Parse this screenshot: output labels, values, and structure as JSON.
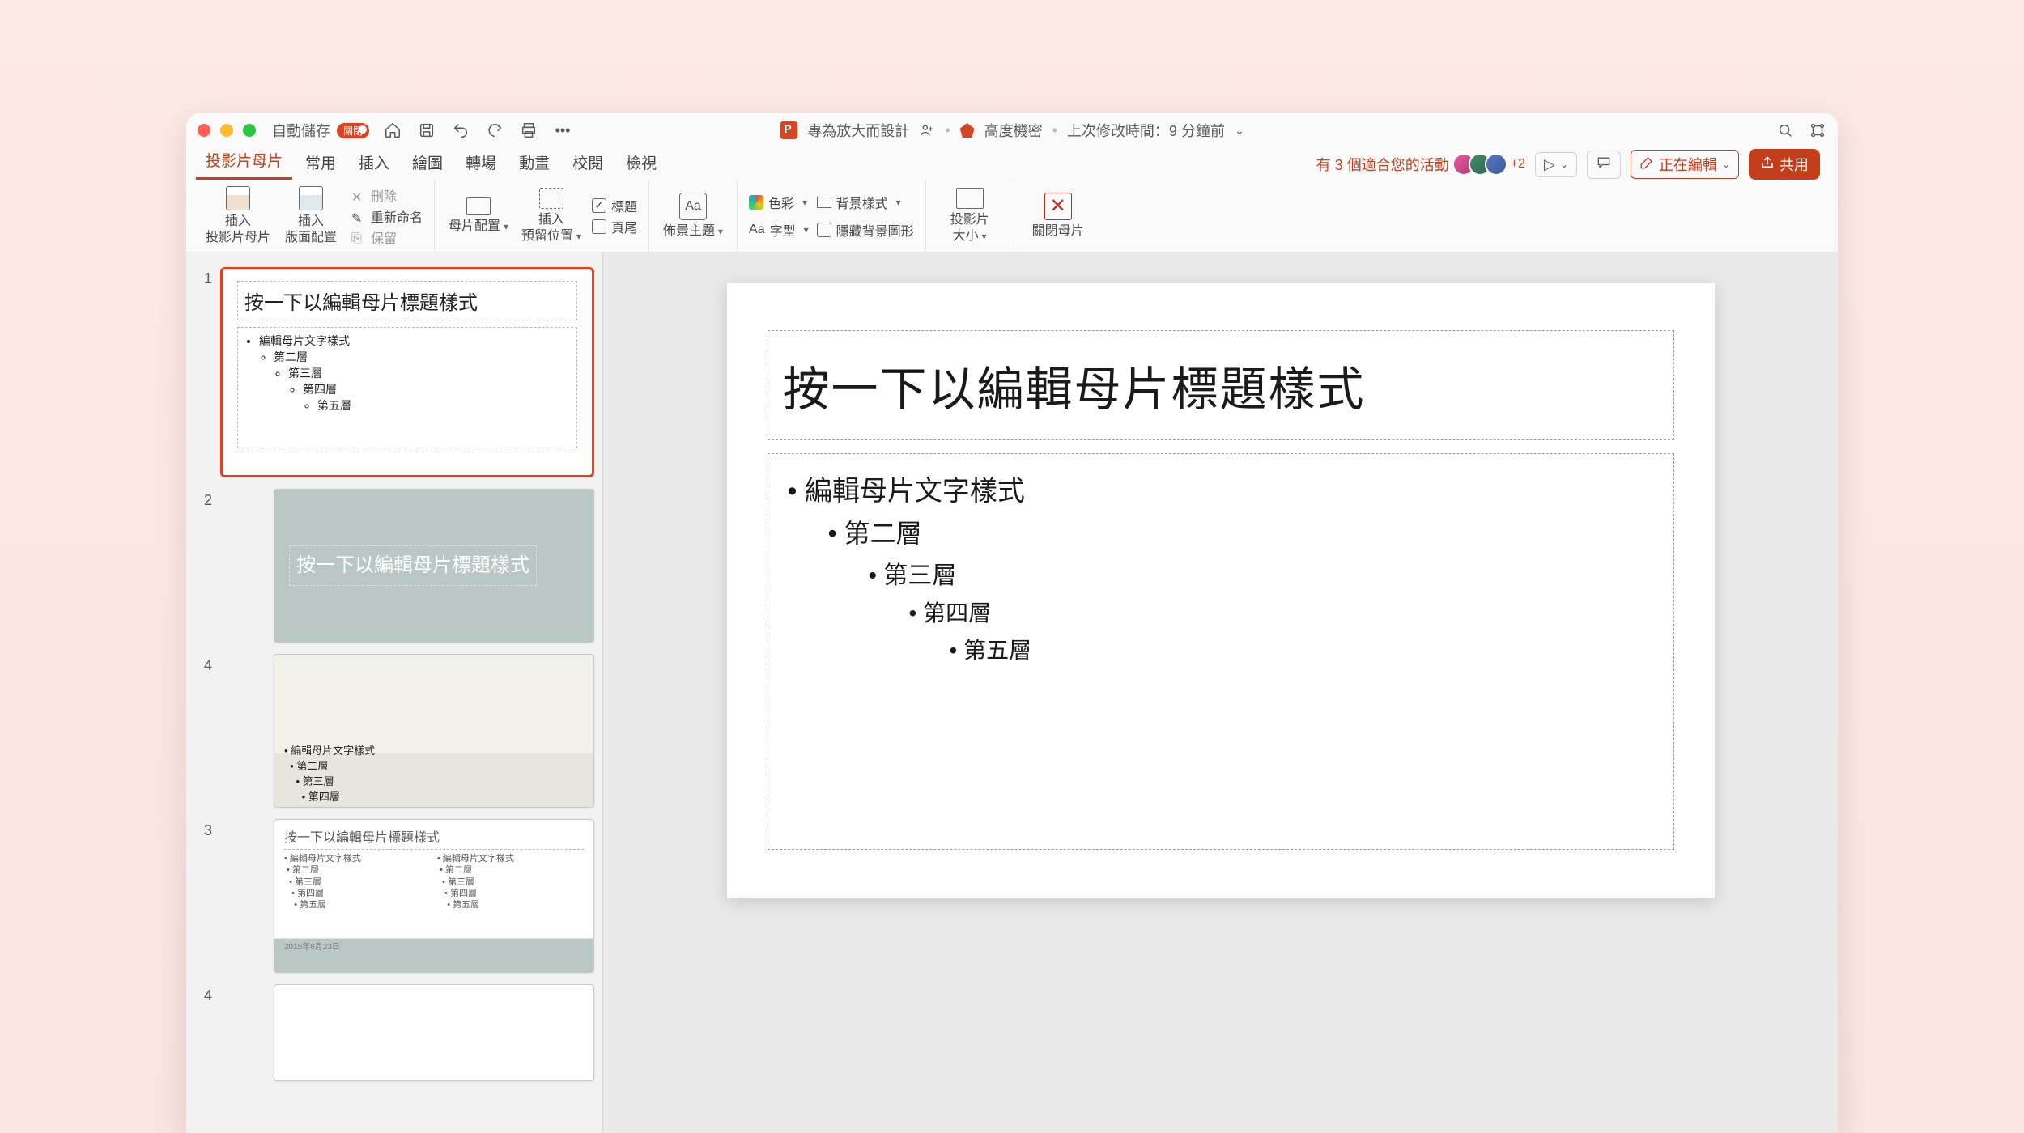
{
  "titlebar": {
    "autosave_label": "自動儲存",
    "autosave_state": "關閉",
    "doc_title": "專為放大而設計",
    "sensitivity": "高度機密",
    "last_modified": "上次修改時間：9 分鐘前"
  },
  "tabs": {
    "slide_master": "投影片母片",
    "home": "常用",
    "insert": "插入",
    "draw": "繪圖",
    "transitions": "轉場",
    "animations": "動畫",
    "review": "校閱",
    "view": "檢視"
  },
  "ribbon_right": {
    "activities": "有 3 個適合您的活動",
    "extra_avatars": "+2",
    "editing": "正在編輯",
    "share": "共用"
  },
  "ribbon": {
    "insert_slide_master": "插入\n投影片母片",
    "insert_layout": "插入\n版面配置",
    "delete": "刪除",
    "rename": "重新命名",
    "preserve": "保留",
    "master_layout": "母片配置",
    "insert_placeholder": "插入\n預留位置",
    "chk_title": "標題",
    "chk_footers": "頁尾",
    "themes": "佈景主題",
    "colors": "色彩",
    "fonts": "字型",
    "bg_styles": "背景樣式",
    "hide_bg": "隱藏背景圖形",
    "slide_size": "投影片\n大小",
    "close_master": "關閉母片"
  },
  "thumbs": {
    "n1": "1",
    "n2": "2",
    "n3": "3",
    "n4": "4",
    "master_title": "按一下以編輯母片標題樣式",
    "body_l1": "編輯母片文字樣式",
    "body_l2": "第二層",
    "body_l3": "第三層",
    "body_l4": "第四層",
    "body_l5": "第五層",
    "section_title": "按一下以編輯母片標題樣式",
    "two_title": "按一下以編輯母片標題樣式",
    "footer_date": "2015年8月23日"
  },
  "slide": {
    "title": "按一下以編輯母片標題樣式",
    "l1": "編輯母片文字樣式",
    "l2": "第二層",
    "l3": "第三層",
    "l4": "第四層",
    "l5": "第五層"
  }
}
